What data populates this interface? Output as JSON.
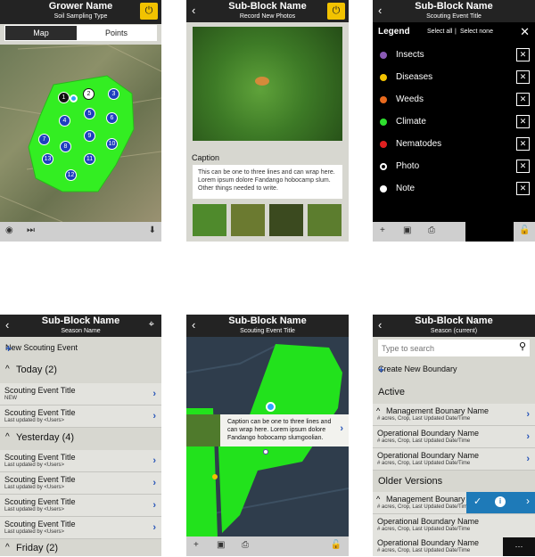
{
  "s1": {
    "title": "Grower Name",
    "subtitle": "Soil Sampling Type",
    "tab_map": "Map",
    "tab_points": "Points",
    "pins": [
      "1",
      "2",
      "3",
      "4",
      "5",
      "6",
      "7",
      "8",
      "9",
      "10",
      "11",
      "12",
      "13"
    ]
  },
  "s2": {
    "title": "Sub-Block Name",
    "subtitle": "Record New Photos",
    "caption_label": "Caption",
    "caption_text": "This can be one to three lines and can wrap here. Lorem ipsum dolore Fandango hobocamp slum. Other things needed to write."
  },
  "s3": {
    "title": "Sub-Block Name",
    "subtitle": "Scouting Event Title",
    "legend": "Legend",
    "select_all": "Select all",
    "divider": "|",
    "select_none": "Select none",
    "items": [
      {
        "label": "Insects",
        "color": "#8a5ab5"
      },
      {
        "label": "Diseases",
        "color": "#f2c200"
      },
      {
        "label": "Weeds",
        "color": "#e86a1e"
      },
      {
        "label": "Climate",
        "color": "#2ee02e"
      },
      {
        "label": "Nematodes",
        "color": "#e02020"
      },
      {
        "label": "Photo",
        "color": "outline"
      },
      {
        "label": "Note",
        "color": "#ffffff"
      }
    ]
  },
  "s4": {
    "title": "Sub-Block Name",
    "subtitle": "Season Name",
    "new_event": "New Scouting Event",
    "today": "Today (2)",
    "yesterday": "Yesterday (4)",
    "friday": "Friday (2)",
    "rows": [
      {
        "a": "Scouting Event Title",
        "b": "NEW"
      },
      {
        "a": "Scouting Event Title",
        "b": "Last updated by <Users>"
      },
      {
        "a": "Scouting Event Title",
        "b": "Last updated by <Users>"
      },
      {
        "a": "Scouting Event Title",
        "b": "Last updated by <Users>"
      },
      {
        "a": "Scouting Event Title",
        "b": "Last updated by <Users>"
      },
      {
        "a": "Scouting Event Title",
        "b": "Last updated by <Users>"
      }
    ]
  },
  "s5": {
    "title": "Sub-Block Name",
    "subtitle": "Scouting Event Title",
    "caption": "Caption can be one to three lines and can wrap here. Lorem ipsum dolore Fandango hobocamp slumgoolian."
  },
  "s6": {
    "title": "Sub-Block Name",
    "subtitle": "Season (current)",
    "search_placeholder": "Type to search",
    "create": "Create New Boundary",
    "active": "Active",
    "older": "Older Versions",
    "rows": [
      {
        "a": "Management Bounary Name",
        "b": "# acres, Crop, Last Updated Date/Time"
      },
      {
        "a": "Operational Boundary Name",
        "b": "# acres, Crop, Last Updated Date/Time"
      },
      {
        "a": "Operational Boundary Name",
        "b": "# acres, Crop, Last Updated Date/Time"
      },
      {
        "a": "Management Bounary Name",
        "b": "# acres, Crop, Last Updated Date/Time"
      },
      {
        "a": "Operational Boundary Name",
        "b": "# acres, Crop, Last Updated Date/Time"
      },
      {
        "a": "Operational Boundary Name",
        "b": "# acres, Crop, Last Updated Date/Time"
      }
    ]
  }
}
